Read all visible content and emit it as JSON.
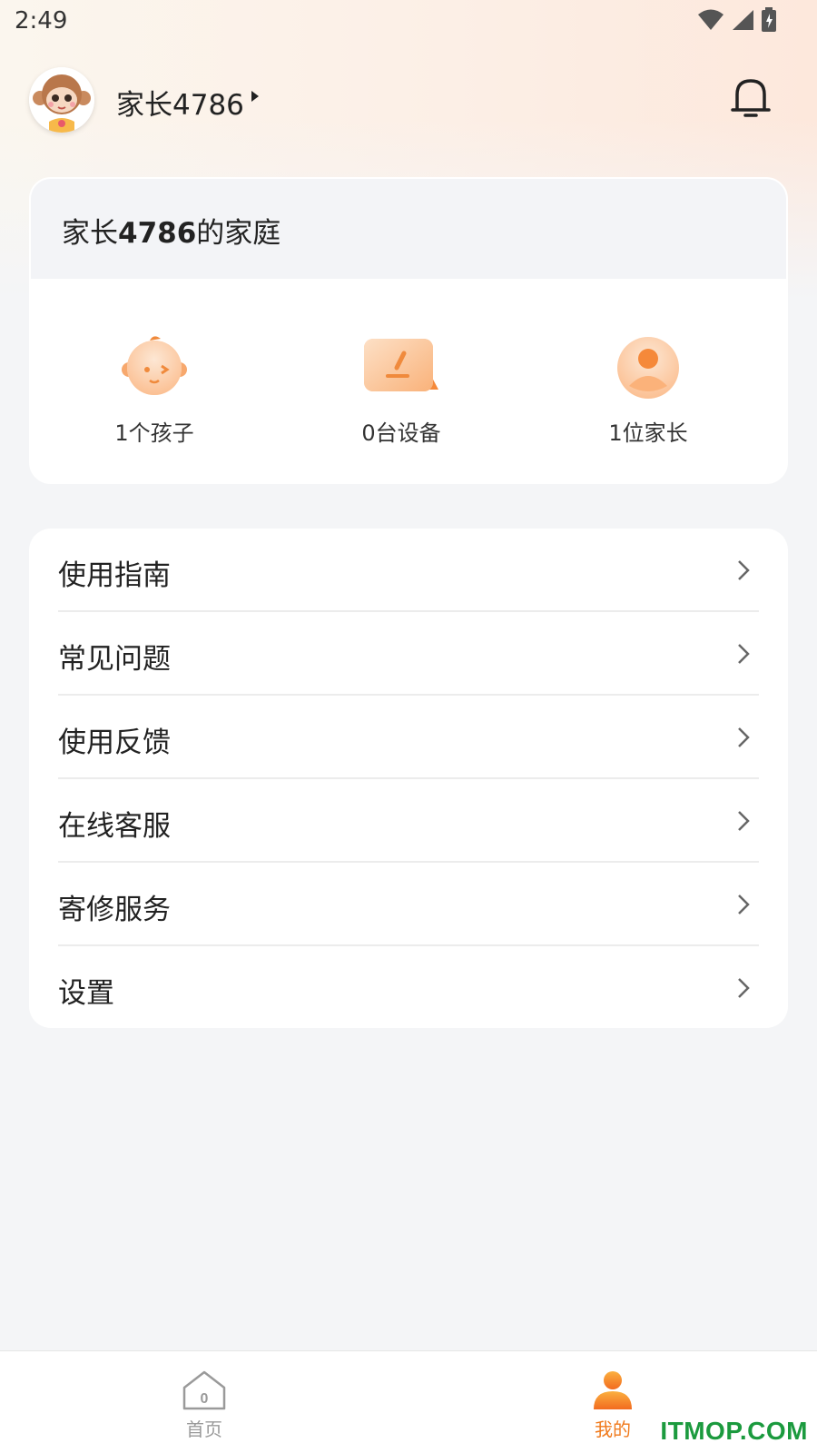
{
  "status_bar": {
    "time": "2:49",
    "icons": [
      "wifi-icon",
      "signal-icon",
      "battery-icon"
    ]
  },
  "header": {
    "user_name": "家长4786"
  },
  "family": {
    "title_prefix": "家长",
    "title_number": "4786",
    "title_suffix": "的家庭",
    "stats": [
      {
        "label": "1个孩子",
        "icon": "child-icon"
      },
      {
        "label": "0台设备",
        "icon": "device-icon"
      },
      {
        "label": "1位家长",
        "icon": "parent-icon"
      }
    ]
  },
  "menu": [
    {
      "label": "使用指南"
    },
    {
      "label": "常见问题"
    },
    {
      "label": "使用反馈"
    },
    {
      "label": "在线客服"
    },
    {
      "label": "寄修服务"
    },
    {
      "label": "设置"
    }
  ],
  "bottom_nav": {
    "tabs": [
      {
        "label": "首页",
        "badge": "0",
        "active": false
      },
      {
        "label": "我的",
        "active": true
      }
    ]
  },
  "watermark": "ITMOP.COM",
  "colors": {
    "accent": "#f07a1c",
    "inactive": "#9a9a9a",
    "background": "#f4f5f7"
  }
}
